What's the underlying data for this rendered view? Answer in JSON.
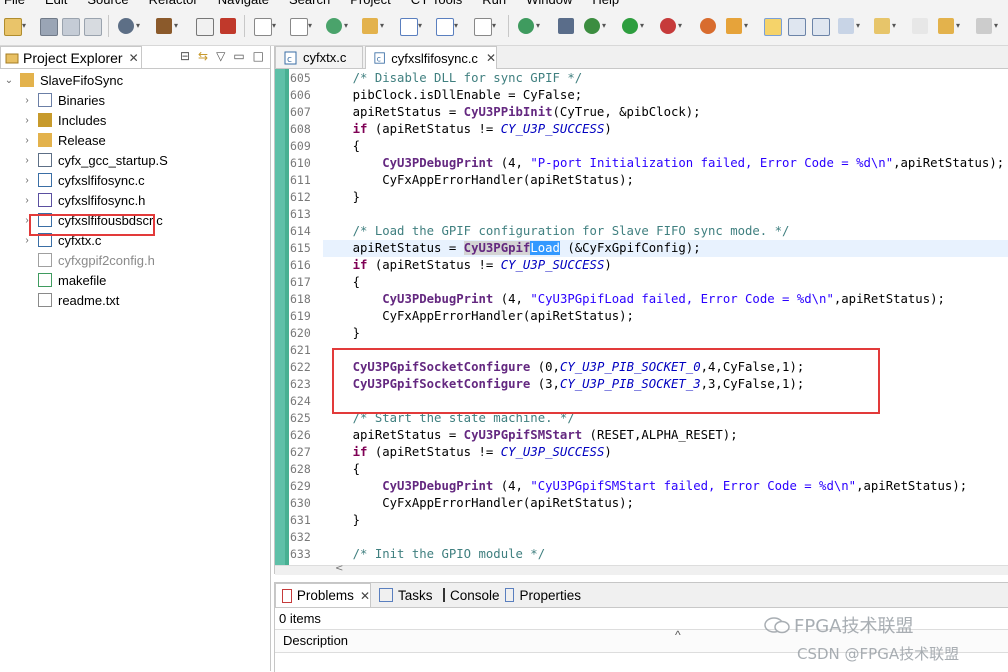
{
  "menu": [
    "File",
    "Edit",
    "Source",
    "Refactor",
    "Navigate",
    "Search",
    "Project",
    "CY Tools",
    "Run",
    "Window",
    "Help"
  ],
  "project_explorer": {
    "tab_label": "Project Explorer",
    "project": "SlaveFifoSync",
    "items": [
      {
        "label": "Binaries",
        "kind": "binaries",
        "expandable": true
      },
      {
        "label": "Includes",
        "kind": "includes",
        "expandable": true
      },
      {
        "label": "Release",
        "kind": "folder",
        "expandable": true
      },
      {
        "label": "cyfx_gcc_startup.S",
        "kind": "asm",
        "expandable": true
      },
      {
        "label": "cyfxslfifosync.c",
        "kind": "c",
        "expandable": true
      },
      {
        "label": "cyfxslfifosync.h",
        "kind": "h",
        "expandable": true
      },
      {
        "label": "cyfxslfifousbdscr.c",
        "kind": "c",
        "expandable": true
      },
      {
        "label": "cyfxtx.c",
        "kind": "c",
        "expandable": true
      },
      {
        "label": "cyfxgpif2config.h",
        "kind": "h-gray",
        "expandable": false
      },
      {
        "label": "makefile",
        "kind": "make",
        "expandable": false
      },
      {
        "label": "readme.txt",
        "kind": "txt",
        "expandable": false
      }
    ]
  },
  "editor": {
    "tabs": [
      {
        "label": "cyfxtx.c",
        "active": false
      },
      {
        "label": "cyfxslfifosync.c",
        "active": true
      }
    ],
    "lines": [
      {
        "n": "605",
        "segs": [
          [
            "    ",
            ""
          ],
          [
            "/* Disable DLL for sync GPIF */",
            "cm"
          ]
        ]
      },
      {
        "n": "606",
        "segs": [
          [
            "    pibClock.",
            ""
          ],
          [
            "isDllEnable",
            "fn-plain"
          ],
          [
            " = CyFalse;",
            ""
          ]
        ]
      },
      {
        "n": "607",
        "segs": [
          [
            "    apiRetStatus = ",
            ""
          ],
          [
            "CyU3PPibInit",
            "fn"
          ],
          [
            "(CyTrue, &pibClock);",
            ""
          ]
        ]
      },
      {
        "n": "608",
        "segs": [
          [
            "    ",
            ""
          ],
          [
            "if",
            "kw"
          ],
          [
            " (apiRetStatus != ",
            ""
          ],
          [
            "CY_U3P_SUCCESS",
            "con"
          ],
          [
            ")",
            ""
          ]
        ]
      },
      {
        "n": "609",
        "segs": [
          [
            "    {",
            ""
          ]
        ]
      },
      {
        "n": "610",
        "segs": [
          [
            "        ",
            ""
          ],
          [
            "CyU3PDebugPrint",
            "fn"
          ],
          [
            " (4, ",
            ""
          ],
          [
            "\"P-port Initialization failed, Error Code = %d\\n\"",
            "str"
          ],
          [
            ",apiRetStatus);",
            ""
          ]
        ]
      },
      {
        "n": "611",
        "segs": [
          [
            "        CyFxAppErrorHandler(apiRetStatus);",
            ""
          ]
        ]
      },
      {
        "n": "612",
        "segs": [
          [
            "    }",
            ""
          ]
        ]
      },
      {
        "n": "613",
        "segs": [
          [
            "",
            ""
          ]
        ]
      },
      {
        "n": "614",
        "segs": [
          [
            "    ",
            ""
          ],
          [
            "/* Load the GPIF configuration for Slave FIFO sync mode. */",
            "cm"
          ]
        ]
      },
      {
        "n": "615",
        "segs": [
          [
            "    apiRetStatus = ",
            ""
          ],
          [
            "CyU3PGpif",
            "fn-hl"
          ],
          [
            "Load",
            "sel"
          ],
          [
            " (&CyFxGpifConfig);",
            ""
          ]
        ],
        "current": true
      },
      {
        "n": "616",
        "segs": [
          [
            "    ",
            ""
          ],
          [
            "if",
            "kw"
          ],
          [
            " (apiRetStatus != ",
            ""
          ],
          [
            "CY_U3P_SUCCESS",
            "con"
          ],
          [
            ")",
            ""
          ]
        ]
      },
      {
        "n": "617",
        "segs": [
          [
            "    {",
            ""
          ]
        ]
      },
      {
        "n": "618",
        "segs": [
          [
            "        ",
            ""
          ],
          [
            "CyU3PDebugPrint",
            "fn"
          ],
          [
            " (4, ",
            ""
          ],
          [
            "\"CyU3PGpifLoad failed, Error Code = %d\\n\"",
            "str"
          ],
          [
            ",apiRetStatus);",
            ""
          ]
        ]
      },
      {
        "n": "619",
        "segs": [
          [
            "        CyFxAppErrorHandler(apiRetStatus);",
            ""
          ]
        ]
      },
      {
        "n": "620",
        "segs": [
          [
            "    }",
            ""
          ]
        ]
      },
      {
        "n": "621",
        "segs": [
          [
            "",
            ""
          ]
        ]
      },
      {
        "n": "622",
        "segs": [
          [
            "    ",
            ""
          ],
          [
            "CyU3PGpifSocketConfigure",
            "fn"
          ],
          [
            " (0,",
            ""
          ],
          [
            "CY_U3P_PIB_SOCKET_0",
            "con"
          ],
          [
            ",4,CyFalse,1);",
            ""
          ]
        ]
      },
      {
        "n": "623",
        "segs": [
          [
            "    ",
            ""
          ],
          [
            "CyU3PGpifSocketConfigure",
            "fn"
          ],
          [
            " (3,",
            ""
          ],
          [
            "CY_U3P_PIB_SOCKET_3",
            "con"
          ],
          [
            ",3,CyFalse,1);",
            ""
          ]
        ]
      },
      {
        "n": "624",
        "segs": [
          [
            "",
            ""
          ]
        ]
      },
      {
        "n": "625",
        "segs": [
          [
            "    ",
            ""
          ],
          [
            "/* Start the state machine. */",
            "cm"
          ]
        ]
      },
      {
        "n": "626",
        "segs": [
          [
            "    apiRetStatus = ",
            ""
          ],
          [
            "CyU3PGpifSMStart",
            "fn"
          ],
          [
            " (RESET,ALPHA_RESET);",
            ""
          ]
        ]
      },
      {
        "n": "627",
        "segs": [
          [
            "    ",
            ""
          ],
          [
            "if",
            "kw"
          ],
          [
            " (apiRetStatus != ",
            ""
          ],
          [
            "CY_U3P_SUCCESS",
            "con"
          ],
          [
            ")",
            ""
          ]
        ]
      },
      {
        "n": "628",
        "segs": [
          [
            "    {",
            ""
          ]
        ]
      },
      {
        "n": "629",
        "segs": [
          [
            "        ",
            ""
          ],
          [
            "CyU3PDebugPrint",
            "fn"
          ],
          [
            " (4, ",
            ""
          ],
          [
            "\"CyU3PGpifSMStart failed, Error Code = %d\\n\"",
            "str"
          ],
          [
            ",apiRetStatus);",
            ""
          ]
        ]
      },
      {
        "n": "630",
        "segs": [
          [
            "        CyFxAppErrorHandler(apiRetStatus);",
            ""
          ]
        ]
      },
      {
        "n": "631",
        "segs": [
          [
            "    }",
            ""
          ]
        ]
      },
      {
        "n": "632",
        "segs": [
          [
            "",
            ""
          ]
        ]
      },
      {
        "n": "633",
        "segs": [
          [
            "    ",
            ""
          ],
          [
            "/* Init the GPIO module */",
            "cm"
          ]
        ]
      }
    ]
  },
  "bottom_panel": {
    "tabs": [
      {
        "label": "Problems",
        "active": true
      },
      {
        "label": "Tasks",
        "active": false
      },
      {
        "label": "Console",
        "active": false
      },
      {
        "label": "Properties",
        "active": false
      }
    ],
    "items_count": "0 items",
    "column_header": "Description"
  },
  "watermark": {
    "line1": "FPGA技术联盟",
    "line2": "CSDN @FPGA技术联盟"
  },
  "colors": {
    "highlight_red": "#e23a3a",
    "comment": "#3f7f7f",
    "keyword": "#7f0055",
    "function": "#642880",
    "constant": "#0000c0",
    "string": "#2a00ff",
    "selection": "#3399ff",
    "ruler": "#5fc0a8"
  }
}
